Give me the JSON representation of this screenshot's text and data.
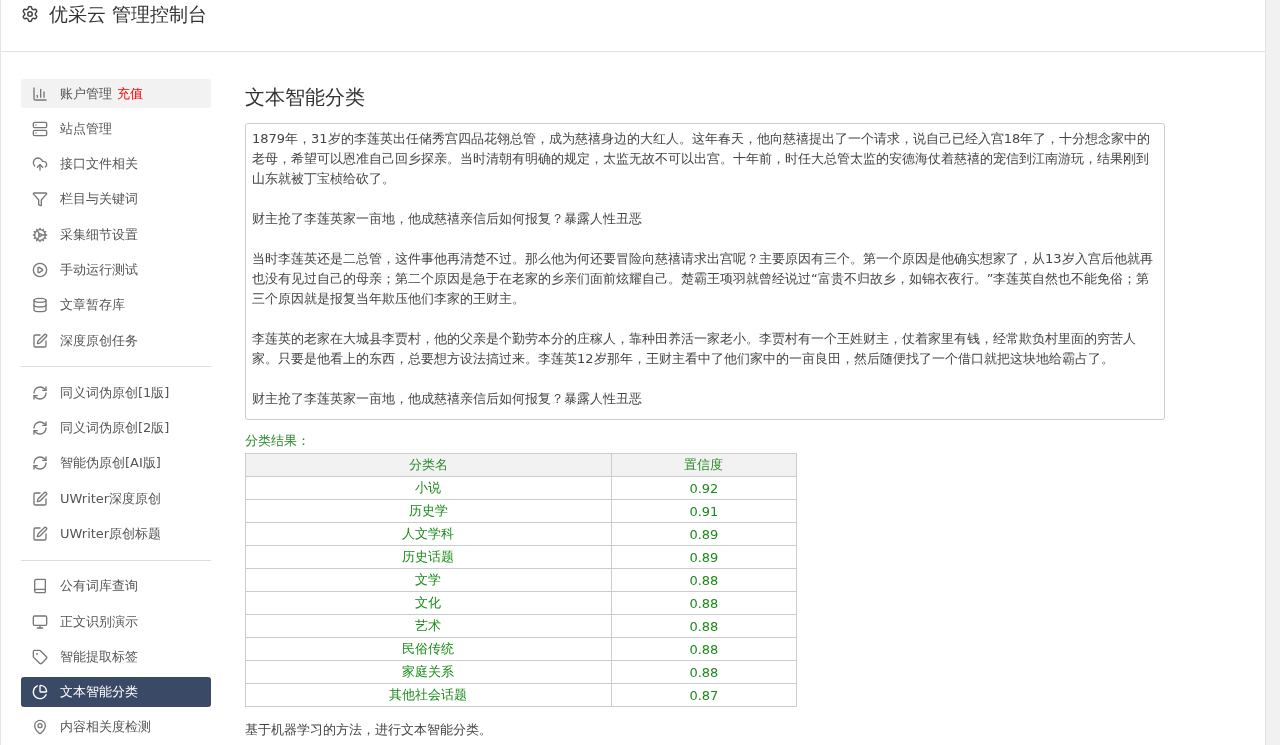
{
  "header": {
    "title": "优采云 管理控制台"
  },
  "sidebar": {
    "groups": [
      {
        "items": [
          {
            "label": "账户管理",
            "badge": "充值",
            "selected": false,
            "hover": true
          },
          {
            "label": "站点管理",
            "selected": false,
            "hover": false
          },
          {
            "label": "接口文件相关",
            "selected": false,
            "hover": false
          },
          {
            "label": "栏目与关键词",
            "selected": false,
            "hover": false
          },
          {
            "label": "采集细节设置",
            "selected": false,
            "hover": false
          },
          {
            "label": "手动运行测试",
            "selected": false,
            "hover": false
          },
          {
            "label": "文章暂存库",
            "selected": false,
            "hover": false
          },
          {
            "label": "深度原创任务",
            "selected": false,
            "hover": false
          }
        ]
      },
      {
        "items": [
          {
            "label": "同义词伪原创[1版]",
            "selected": false,
            "hover": false
          },
          {
            "label": "同义词伪原创[2版]",
            "selected": false,
            "hover": false
          },
          {
            "label": "智能伪原创[AI版]",
            "selected": false,
            "hover": false
          },
          {
            "label": "UWriter深度原创",
            "selected": false,
            "hover": false
          },
          {
            "label": "UWriter原创标题",
            "selected": false,
            "hover": false
          }
        ]
      },
      {
        "items": [
          {
            "label": "公有词库查询",
            "selected": false,
            "hover": false
          },
          {
            "label": "正文识别演示",
            "selected": false,
            "hover": false
          },
          {
            "label": "智能提取标签",
            "selected": false,
            "hover": false
          },
          {
            "label": "文本智能分类",
            "selected": true,
            "hover": false
          },
          {
            "label": "内容相关度检测",
            "selected": false,
            "hover": false
          }
        ]
      }
    ]
  },
  "main": {
    "title": "文本智能分类",
    "text_area": {
      "paragraphs": [
        "1879年，31岁的李莲英出任储秀宫四品花翎总管，成为慈禧身边的大红人。这年春天，他向慈禧提出了一个请求，说自己已经入宫18年了，十分想念家中的老母，希望可以恩准自己回乡探亲。当时清朝有明确的规定，太监无故不可以出宫。十年前，时任大总管太监的安德海仗着慈禧的宠信到江南游玩，结果刚到山东就被丁宝桢给砍了。",
        "财主抢了李莲英家一亩地，他成慈禧亲信后如何报复？暴露人性丑恶",
        "当时李莲英还是二总管，这件事他再清楚不过。那么他为何还要冒险向慈禧请求出宫呢？主要原因有三个。第一个原因是他确实想家了，从13岁入宫后他就再也没有见过自己的母亲；第二个原因是急于在老家的乡亲们面前炫耀自己。楚霸王项羽就曾经说过“富贵不归故乡，如锦衣夜行。”李莲英自然也不能免俗；第三个原因就是报复当年欺压他们李家的王财主。",
        "李莲英的老家在大城县李贾村，他的父亲是个勤劳本分的庄稼人，靠种田养活一家老小。李贾村有一个王姓财主，仗着家里有钱，经常欺负村里面的穷苦人家。只要是他看上的东西，总要想方设法搞过来。李莲英12岁那年，王财主看中了他们家中的一亩良田，然后随便找了一个借口就把这块地给霸占了。",
        "财主抢了李莲英家一亩地，他成慈禧亲信后如何报复？暴露人性丑恶"
      ]
    },
    "result_label": "分类结果：",
    "table": {
      "columns": [
        "分类名",
        "置信度"
      ],
      "rows": [
        [
          "小说",
          "0.92"
        ],
        [
          "历史学",
          "0.91"
        ],
        [
          "人文学科",
          "0.89"
        ],
        [
          "历史话题",
          "0.89"
        ],
        [
          "文学",
          "0.88"
        ],
        [
          "文化",
          "0.88"
        ],
        [
          "艺术",
          "0.88"
        ],
        [
          "民俗传统",
          "0.88"
        ],
        [
          "家庭关系",
          "0.88"
        ],
        [
          "其他社会话题",
          "0.87"
        ]
      ]
    },
    "footnote": "基于机器学习的方法，进行文本智能分类。"
  }
}
